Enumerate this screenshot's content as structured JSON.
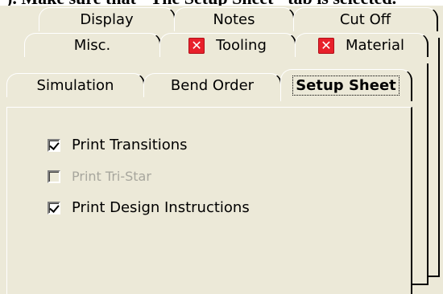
{
  "tabs": {
    "row1": [
      {
        "label": "Display"
      },
      {
        "label": "Notes"
      },
      {
        "label": "Cut Off"
      }
    ],
    "row2": [
      {
        "label": "Misc.",
        "error": false
      },
      {
        "label": "Tooling",
        "error": true
      },
      {
        "label": "Material",
        "error": true
      }
    ],
    "row3": [
      {
        "label": "Simulation"
      },
      {
        "label": "Bend Order"
      },
      {
        "label": "Setup Sheet",
        "active": true
      }
    ]
  },
  "error_icon": "x-error-icon",
  "checkboxes": [
    {
      "label": "Print Transitions",
      "checked": true,
      "enabled": true
    },
    {
      "label": "Print Tri-Star",
      "checked": false,
      "enabled": false
    },
    {
      "label": "Print Design Instructions",
      "checked": true,
      "enabled": true
    }
  ],
  "colors": {
    "dialog_bg": "#ece9d8",
    "error_red": "#e8202b"
  }
}
